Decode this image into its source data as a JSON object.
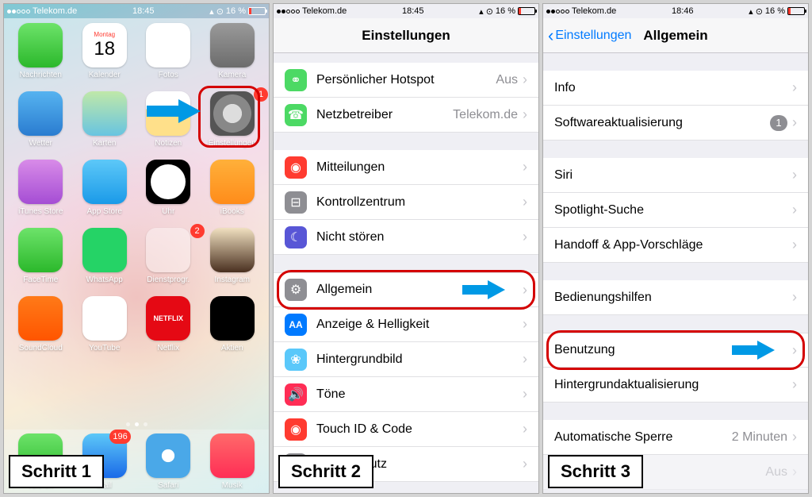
{
  "status": {
    "carrier": "Telekom.de",
    "time1": "18:45",
    "time2": "18:45",
    "time3": "18:46",
    "battery_pct": "16 %",
    "location_icon": "▴",
    "alarm_icon": "⏰"
  },
  "steps": {
    "s1": "Schritt 1",
    "s2": "Schritt 2",
    "s3": "Schritt 3"
  },
  "home": {
    "date_day": "Montag",
    "date_num": "18",
    "apps_row1": [
      "Nachrichten",
      "Kalender",
      "Fotos",
      "Kamera"
    ],
    "apps_row2": [
      "Wetter",
      "Karten",
      "Notizen",
      "Einstellungen"
    ],
    "apps_row3": [
      "iTunes Store",
      "App Store",
      "Uhr",
      "iBooks"
    ],
    "apps_row4": [
      "FaceTime",
      "WhatsApp",
      "Dienstprogr.",
      "Instagram"
    ],
    "apps_row5": [
      "SoundCloud",
      "YouTube",
      "Netflix",
      "Aktien"
    ],
    "dock": [
      "Telefon",
      "Mail",
      "Safari",
      "Musik"
    ],
    "mail_badge": "196",
    "settings_badge": "1",
    "dienst_badge": "2"
  },
  "settings": {
    "title": "Einstellungen",
    "rows": {
      "hotspot": "Persönlicher Hotspot",
      "hotspot_val": "Aus",
      "carrier": "Netzbetreiber",
      "carrier_val": "Telekom.de",
      "notifications": "Mitteilungen",
      "control": "Kontrollzentrum",
      "dnd": "Nicht stören",
      "general": "Allgemein",
      "display": "Anzeige & Helligkeit",
      "wallpaper": "Hintergrundbild",
      "sounds": "Töne",
      "touchid": "Touch ID & Code",
      "privacy": "Datenschutz"
    }
  },
  "general": {
    "back": "Einstellungen",
    "title": "Allgemein",
    "rows": {
      "info": "Info",
      "update": "Softwareaktualisierung",
      "update_badge": "1",
      "siri": "Siri",
      "spotlight": "Spotlight-Suche",
      "handoff": "Handoff & App-Vorschläge",
      "accessibility": "Bedienungshilfen",
      "usage": "Benutzung",
      "bgrefresh": "Hintergrundaktualisierung",
      "autolock": "Automatische Sperre",
      "autolock_val": "2 Minuten",
      "restrictions_val": "Aus"
    }
  }
}
